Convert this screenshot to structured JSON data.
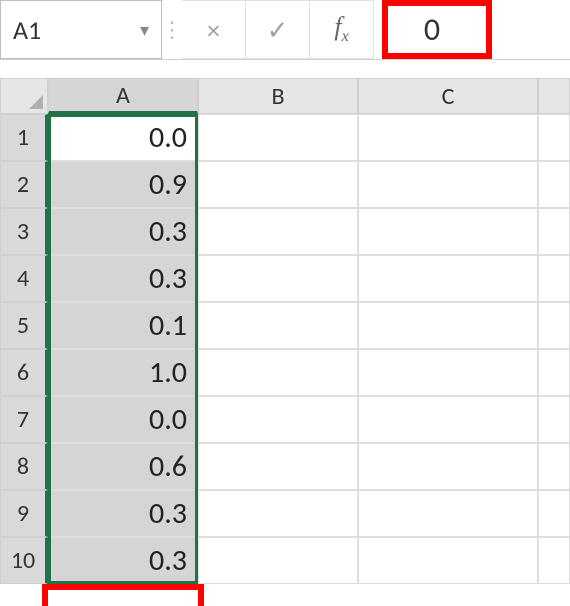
{
  "name_box": {
    "value": "A1"
  },
  "formula_bar": {
    "cancel_glyph": "×",
    "enter_glyph": "✓",
    "fx_label": "fx",
    "value": "0"
  },
  "columns": [
    "A",
    "B",
    "C",
    ""
  ],
  "rows": [
    {
      "num": "1",
      "A": "0.0"
    },
    {
      "num": "2",
      "A": "0.9"
    },
    {
      "num": "3",
      "A": "0.3"
    },
    {
      "num": "4",
      "A": "0.3"
    },
    {
      "num": "5",
      "A": "0.1"
    },
    {
      "num": "6",
      "A": "1.0"
    },
    {
      "num": "7",
      "A": "0.0"
    },
    {
      "num": "8",
      "A": "0.6"
    },
    {
      "num": "9",
      "A": "0.3"
    },
    {
      "num": "10",
      "A": "0.3"
    }
  ],
  "chart_data": {
    "type": "table",
    "title": "",
    "columns": [
      "A"
    ],
    "rows": [
      [
        0.0
      ],
      [
        0.9
      ],
      [
        0.3
      ],
      [
        0.3
      ],
      [
        0.1
      ],
      [
        1.0
      ],
      [
        0.0
      ],
      [
        0.6
      ],
      [
        0.3
      ],
      [
        0.3
      ]
    ]
  }
}
